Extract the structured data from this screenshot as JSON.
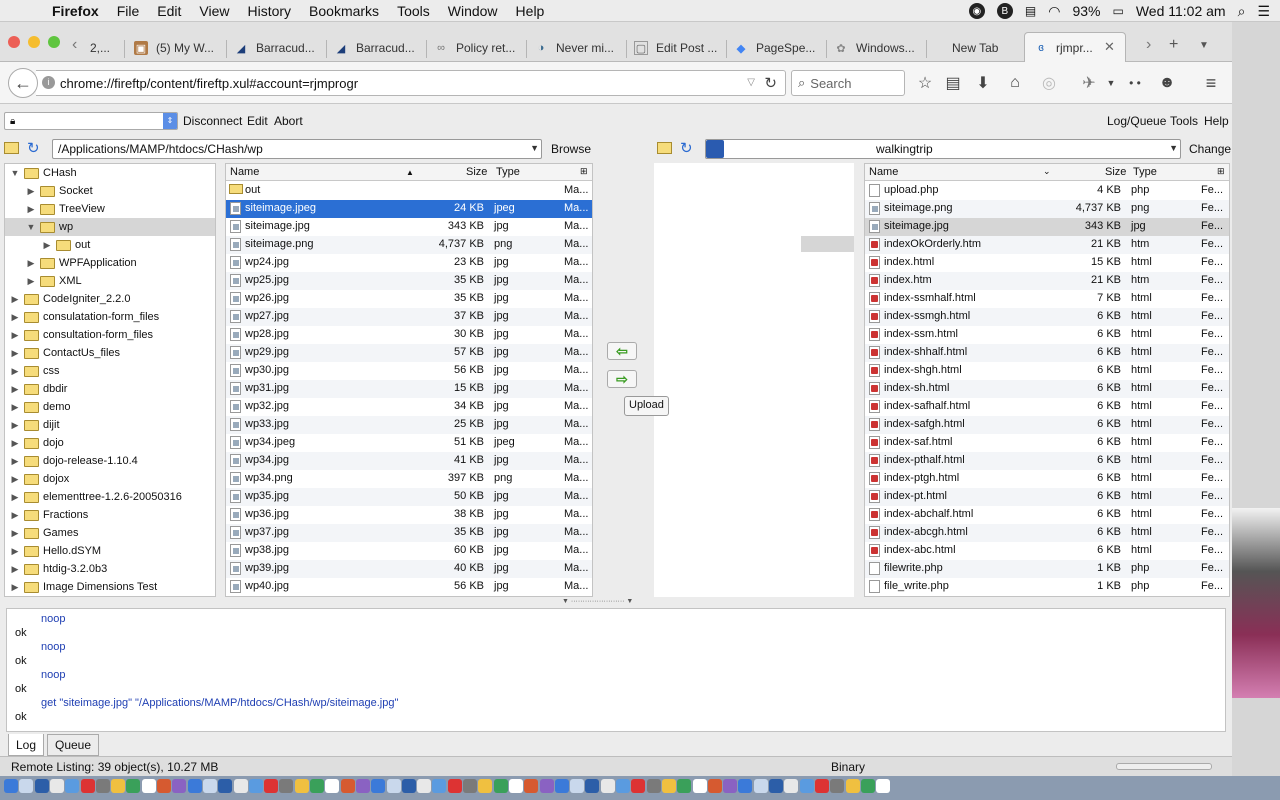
{
  "menubar": {
    "app_name": "Firefox",
    "items": [
      "File",
      "Edit",
      "View",
      "History",
      "Bookmarks",
      "Tools",
      "Window",
      "Help"
    ],
    "battery": "93%",
    "clock": "Wed 11:02 am"
  },
  "tabs": [
    {
      "label": "2,..."
    },
    {
      "label": "(5) My W..."
    },
    {
      "label": "Barracud..."
    },
    {
      "label": "Barracud..."
    },
    {
      "label": "Policy ret..."
    },
    {
      "label": "Never mi..."
    },
    {
      "label": "Edit Post ..."
    },
    {
      "label": "PageSpe..."
    },
    {
      "label": "Windows..."
    },
    {
      "label": "New Tab"
    },
    {
      "label": "rjmpr..."
    }
  ],
  "nav": {
    "url": "chrome://fireftp/content/fireftp.xul#account=rjmprogr",
    "search_placeholder": "Search"
  },
  "ftp_toolbar": {
    "disconnect": "Disconnect",
    "edit": "Edit",
    "abort": "Abort",
    "log_queue": "Log/Queue",
    "tools": "Tools",
    "help": "Help"
  },
  "local": {
    "path": "/Applications/MAMP/htdocs/CHash/wp",
    "browse": "Browse",
    "tree": [
      {
        "label": "CHash",
        "indent": 0,
        "open": true
      },
      {
        "label": "Socket",
        "indent": 1,
        "open": false
      },
      {
        "label": "TreeView",
        "indent": 1,
        "open": false
      },
      {
        "label": "wp",
        "indent": 1,
        "open": true,
        "selected": true
      },
      {
        "label": "out",
        "indent": 2,
        "open": false
      },
      {
        "label": "WPFApplication",
        "indent": 1,
        "open": false
      },
      {
        "label": "XML",
        "indent": 1,
        "open": false
      },
      {
        "label": "CodeIgniter_2.2.0",
        "indent": 0,
        "open": false
      },
      {
        "label": "consulatation-form_files",
        "indent": 0,
        "open": false
      },
      {
        "label": "consultation-form_files",
        "indent": 0,
        "open": false
      },
      {
        "label": "ContactUs_files",
        "indent": 0,
        "open": false
      },
      {
        "label": "css",
        "indent": 0,
        "open": false
      },
      {
        "label": "dbdir",
        "indent": 0,
        "open": false
      },
      {
        "label": "demo",
        "indent": 0,
        "open": false
      },
      {
        "label": "dijit",
        "indent": 0,
        "open": false
      },
      {
        "label": "dojo",
        "indent": 0,
        "open": false
      },
      {
        "label": "dojo-release-1.10.4",
        "indent": 0,
        "open": false
      },
      {
        "label": "dojox",
        "indent": 0,
        "open": false
      },
      {
        "label": "elementtree-1.2.6-20050316",
        "indent": 0,
        "open": false
      },
      {
        "label": "Fractions",
        "indent": 0,
        "open": false
      },
      {
        "label": "Games",
        "indent": 0,
        "open": false
      },
      {
        "label": "Hello.dSYM",
        "indent": 0,
        "open": false
      },
      {
        "label": "htdig-3.2.0b3",
        "indent": 0,
        "open": false
      },
      {
        "label": "Image Dimensions Test",
        "indent": 0,
        "open": false
      }
    ],
    "columns": {
      "name": "Name",
      "size": "Size",
      "type": "Type"
    },
    "files": [
      {
        "name": "out",
        "size": "",
        "type": "",
        "date": "Ma...",
        "kind": "folder"
      },
      {
        "name": "siteimage.jpeg",
        "size": "24 KB",
        "type": "jpeg",
        "date": "Ma...",
        "kind": "img",
        "selected": true
      },
      {
        "name": "siteimage.jpg",
        "size": "343 KB",
        "type": "jpg",
        "date": "Ma...",
        "kind": "img"
      },
      {
        "name": "siteimage.png",
        "size": "4,737 KB",
        "type": "png",
        "date": "Ma...",
        "kind": "img"
      },
      {
        "name": "wp24.jpg",
        "size": "23 KB",
        "type": "jpg",
        "date": "Ma...",
        "kind": "img"
      },
      {
        "name": "wp25.jpg",
        "size": "35 KB",
        "type": "jpg",
        "date": "Ma...",
        "kind": "img"
      },
      {
        "name": "wp26.jpg",
        "size": "35 KB",
        "type": "jpg",
        "date": "Ma...",
        "kind": "img"
      },
      {
        "name": "wp27.jpg",
        "size": "37 KB",
        "type": "jpg",
        "date": "Ma...",
        "kind": "img"
      },
      {
        "name": "wp28.jpg",
        "size": "30 KB",
        "type": "jpg",
        "date": "Ma...",
        "kind": "img"
      },
      {
        "name": "wp29.jpg",
        "size": "57 KB",
        "type": "jpg",
        "date": "Ma...",
        "kind": "img"
      },
      {
        "name": "wp30.jpg",
        "size": "56 KB",
        "type": "jpg",
        "date": "Ma...",
        "kind": "img"
      },
      {
        "name": "wp31.jpg",
        "size": "15 KB",
        "type": "jpg",
        "date": "Ma...",
        "kind": "img"
      },
      {
        "name": "wp32.jpg",
        "size": "34 KB",
        "type": "jpg",
        "date": "Ma...",
        "kind": "img"
      },
      {
        "name": "wp33.jpg",
        "size": "25 KB",
        "type": "jpg",
        "date": "Ma...",
        "kind": "img"
      },
      {
        "name": "wp34.jpeg",
        "size": "51 KB",
        "type": "jpeg",
        "date": "Ma...",
        "kind": "img"
      },
      {
        "name": "wp34.jpg",
        "size": "41 KB",
        "type": "jpg",
        "date": "Ma...",
        "kind": "img"
      },
      {
        "name": "wp34.png",
        "size": "397 KB",
        "type": "png",
        "date": "Ma...",
        "kind": "img"
      },
      {
        "name": "wp35.jpg",
        "size": "50 KB",
        "type": "jpg",
        "date": "Ma...",
        "kind": "img"
      },
      {
        "name": "wp36.jpg",
        "size": "38 KB",
        "type": "jpg",
        "date": "Ma...",
        "kind": "img"
      },
      {
        "name": "wp37.jpg",
        "size": "35 KB",
        "type": "jpg",
        "date": "Ma...",
        "kind": "img"
      },
      {
        "name": "wp38.jpg",
        "size": "60 KB",
        "type": "jpg",
        "date": "Ma...",
        "kind": "img"
      },
      {
        "name": "wp39.jpg",
        "size": "40 KB",
        "type": "jpg",
        "date": "Ma...",
        "kind": "img"
      },
      {
        "name": "wp40.jpg",
        "size": "56 KB",
        "type": "jpg",
        "date": "Ma...",
        "kind": "img"
      }
    ]
  },
  "transfer": {
    "upload_tooltip": "Upload"
  },
  "remote": {
    "path": "walkingtrip",
    "change": "Change",
    "columns": {
      "name": "Name",
      "size": "Size",
      "type": "Type"
    },
    "files": [
      {
        "name": "upload.php",
        "size": "4 KB",
        "type": "php",
        "date": "Fe...",
        "kind": "plain"
      },
      {
        "name": "siteimage.png",
        "size": "4,737 KB",
        "type": "png",
        "date": "Fe...",
        "kind": "img"
      },
      {
        "name": "siteimage.jpg",
        "size": "343 KB",
        "type": "jpg",
        "date": "Fe...",
        "kind": "img",
        "selected": true
      },
      {
        "name": "indexOkOrderly.htm",
        "size": "21 KB",
        "type": "htm",
        "date": "Fe...",
        "kind": "html"
      },
      {
        "name": "index.html",
        "size": "15 KB",
        "type": "html",
        "date": "Fe...",
        "kind": "html"
      },
      {
        "name": "index.htm",
        "size": "21 KB",
        "type": "htm",
        "date": "Fe...",
        "kind": "html"
      },
      {
        "name": "index-ssmhalf.html",
        "size": "7 KB",
        "type": "html",
        "date": "Fe...",
        "kind": "html"
      },
      {
        "name": "index-ssmgh.html",
        "size": "6 KB",
        "type": "html",
        "date": "Fe...",
        "kind": "html"
      },
      {
        "name": "index-ssm.html",
        "size": "6 KB",
        "type": "html",
        "date": "Fe...",
        "kind": "html"
      },
      {
        "name": "index-shhalf.html",
        "size": "6 KB",
        "type": "html",
        "date": "Fe...",
        "kind": "html"
      },
      {
        "name": "index-shgh.html",
        "size": "6 KB",
        "type": "html",
        "date": "Fe...",
        "kind": "html"
      },
      {
        "name": "index-sh.html",
        "size": "6 KB",
        "type": "html",
        "date": "Fe...",
        "kind": "html"
      },
      {
        "name": "index-safhalf.html",
        "size": "6 KB",
        "type": "html",
        "date": "Fe...",
        "kind": "html"
      },
      {
        "name": "index-safgh.html",
        "size": "6 KB",
        "type": "html",
        "date": "Fe...",
        "kind": "html"
      },
      {
        "name": "index-saf.html",
        "size": "6 KB",
        "type": "html",
        "date": "Fe...",
        "kind": "html"
      },
      {
        "name": "index-pthalf.html",
        "size": "6 KB",
        "type": "html",
        "date": "Fe...",
        "kind": "html"
      },
      {
        "name": "index-ptgh.html",
        "size": "6 KB",
        "type": "html",
        "date": "Fe...",
        "kind": "html"
      },
      {
        "name": "index-pt.html",
        "size": "6 KB",
        "type": "html",
        "date": "Fe...",
        "kind": "html"
      },
      {
        "name": "index-abchalf.html",
        "size": "6 KB",
        "type": "html",
        "date": "Fe...",
        "kind": "html"
      },
      {
        "name": "index-abcgh.html",
        "size": "6 KB",
        "type": "html",
        "date": "Fe...",
        "kind": "html"
      },
      {
        "name": "index-abc.html",
        "size": "6 KB",
        "type": "html",
        "date": "Fe...",
        "kind": "html"
      },
      {
        "name": "filewrite.php",
        "size": "1 KB",
        "type": "php",
        "date": "Fe...",
        "kind": "plain"
      },
      {
        "name": "file_write.php",
        "size": "1 KB",
        "type": "php",
        "date": "Fe...",
        "kind": "plain"
      }
    ]
  },
  "log": {
    "lines": [
      {
        "text": "noop",
        "cmd": true
      },
      {
        "text": "ok",
        "cmd": false
      },
      {
        "text": "noop",
        "cmd": true
      },
      {
        "text": "ok",
        "cmd": false
      },
      {
        "text": "noop",
        "cmd": true
      },
      {
        "text": "ok",
        "cmd": false
      },
      {
        "text": "get \"siteimage.jpg\" \"/Applications/MAMP/htdocs/CHash/wp/siteimage.jpg\"",
        "cmd": true
      },
      {
        "text": "ok",
        "cmd": false
      }
    ],
    "tab_log": "Log",
    "tab_queue": "Queue"
  },
  "status": {
    "left": "Remote Listing: 39 object(s), 10.27 MB",
    "mode": "Binary"
  },
  "colors": {
    "selection": "#2b6fd4",
    "log_command": "#1f3fb3",
    "arrow_green": "#3a9c22"
  }
}
